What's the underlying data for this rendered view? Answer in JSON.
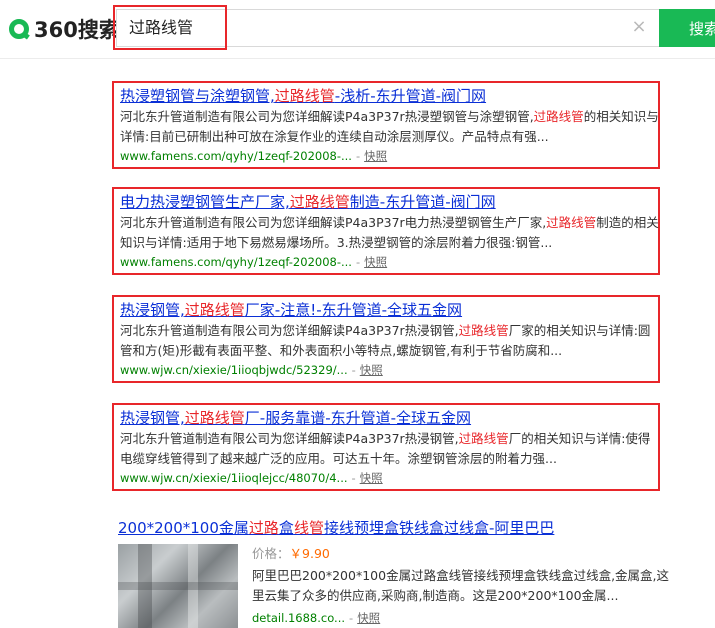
{
  "logo": {
    "text": "360搜索"
  },
  "search": {
    "query": "过路线管",
    "button_label": "搜索",
    "clear_glyph": "×"
  },
  "colors": {
    "brand_green": "#19b955",
    "highlight_red": "#e8262a",
    "link_blue": "#0a2fd6",
    "url_green": "#008000",
    "price_orange": "#ff6a00"
  },
  "results": [
    {
      "title_a": "热浸塑钢管与涂塑钢管,",
      "title_em": "过路线管",
      "title_b": "-浅析-东升管道-阀门网",
      "desc_a": "河北东升管道制造有限公司为您详细解读P4a3P37r热浸塑钢管与涂塑钢管,",
      "desc_em": "过路线管",
      "desc_b": "的相关知识与详情:目前已研制出种可放在涂复作业的连续自动涂层测厚仪。产品特点有强...",
      "url": "www.famens.com/qyhy/1zeqf-202008-...",
      "sep": "-",
      "snapshot": "快照"
    },
    {
      "title_a": "电力热浸塑钢管生产厂家,",
      "title_em": "过路线管",
      "title_b": "制造-东升管道-阀门网",
      "desc_a": "河北东升管道制造有限公司为您详细解读P4a3P37r电力热浸塑钢管生产厂家,",
      "desc_em": "过路线管",
      "desc_b": "制造的相关知识与详情:适用于地下易燃易爆场所。3.热浸塑钢管的涂层附着力很强:钢管...",
      "url": "www.famens.com/qyhy/1zeqf-202008-...",
      "sep": "-",
      "snapshot": "快照"
    },
    {
      "title_a": "热浸钢管,",
      "title_em": "过路线管",
      "title_b": "厂家-注意!-东升管道-全球五金网",
      "desc_a": "河北东升管道制造有限公司为您详细解读P4a3P37r热浸钢管,",
      "desc_em": "过路线管",
      "desc_b": "厂家的相关知识与详情:圆管和方(矩)形截有表面平整、和外表面积小等特点,螺旋钢管,有利于节省防腐和...",
      "url": "www.wjw.cn/xiexie/1iioqbjwdc/52329/...",
      "sep": "-",
      "snapshot": "快照"
    },
    {
      "title_a": "热浸钢管,",
      "title_em": "过路线管",
      "title_b": "厂-服务靠谱-东升管道-全球五金网",
      "desc_a": "河北东升管道制造有限公司为您详细解读P4a3P37r热浸钢管,",
      "desc_em": "过路线管",
      "desc_b": "厂的相关知识与详情:使得电缆穿线管得到了越来越广泛的应用。可达五十年。涂塑钢管涂层的附着力强...",
      "url": "www.wjw.cn/xiexie/1iioqlejcc/48070/4...",
      "sep": "-",
      "snapshot": "快照"
    }
  ],
  "alibaba": {
    "title_a": "200*200*100金属",
    "title_em1": "过路",
    "title_b": "盒",
    "title_em2": "线管",
    "title_c": "接线预埋盒铁线盒过线盒-阿里巴巴",
    "price_label": "价格：",
    "price_value": "￥9.90",
    "desc": "阿里巴巴200*200*100金属过路盒线管接线预埋盒铁线盒过线盒,金属盒,这里云集了众多的供应商,采购商,制造商。这是200*200*100金属...",
    "url": "detail.1688.co...",
    "sep": "-",
    "snapshot": "快照"
  }
}
